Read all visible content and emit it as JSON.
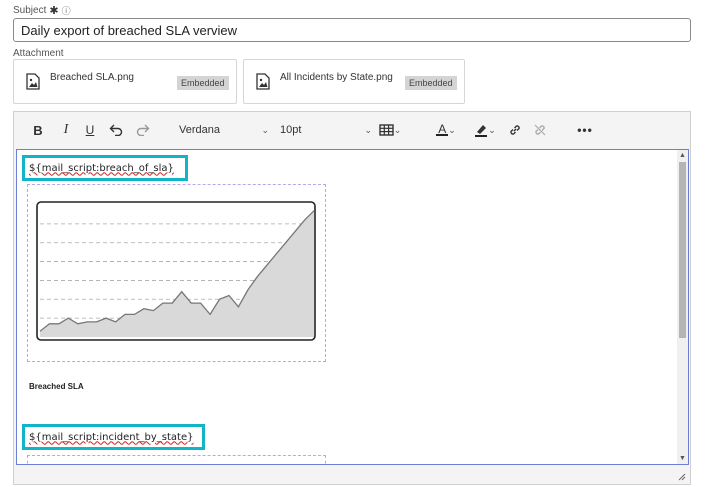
{
  "subject": {
    "label": "Subject",
    "required_mark": "✱",
    "info_mark": "ⓘ",
    "value": "Daily export of breached SLA verview"
  },
  "attachment": {
    "label": "Attachment",
    "files": [
      {
        "name": "Breached SLA.png",
        "badge": "Embedded"
      },
      {
        "name": "All Incidents by State.png",
        "badge": "Embedded"
      }
    ]
  },
  "toolbar": {
    "bold": "B",
    "italic": "I",
    "underline": "U",
    "undo": "↶",
    "redo": "↷",
    "font": "Verdana",
    "font_size": "10pt",
    "text_color_glyph": "A",
    "more": "•••"
  },
  "content": {
    "script1": "${mail_script:breach_of_sla}",
    "script2": "${mail_script:incident_by_state}",
    "caption": "Breached SLA"
  },
  "chart_data": {
    "type": "area",
    "x": [
      0,
      1,
      2,
      3,
      4,
      5,
      6,
      7,
      8,
      9,
      10,
      11,
      12,
      13,
      14,
      15,
      16,
      17,
      18,
      19,
      20,
      21,
      22,
      23,
      24,
      25,
      26,
      27,
      28,
      29
    ],
    "values": [
      3,
      7,
      7,
      10,
      7,
      8,
      8,
      10,
      8,
      12,
      12,
      15,
      14,
      18,
      18,
      24,
      18,
      18,
      12,
      20,
      22,
      16,
      25,
      32,
      38,
      44,
      50,
      56,
      62,
      67
    ],
    "ylim": [
      0,
      70
    ],
    "grid": true,
    "colors": {
      "fill": "#d9d9d9",
      "line": "#777777",
      "grid": "#aaaaaa",
      "frame": "#222222"
    }
  }
}
